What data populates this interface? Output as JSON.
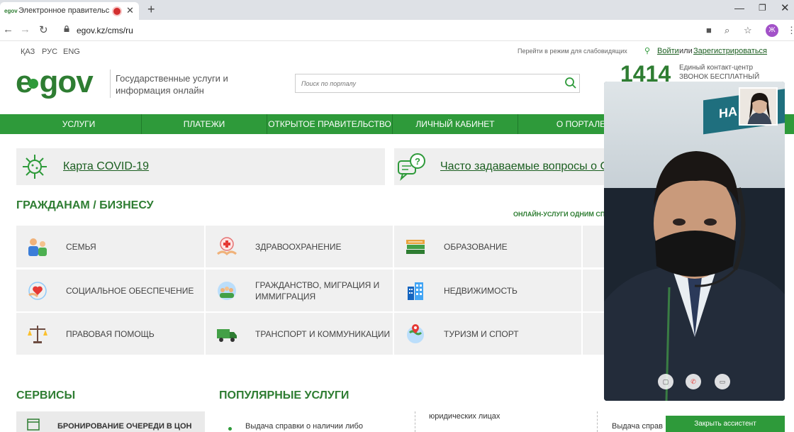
{
  "browser": {
    "tab_title": "Электронное правительство",
    "tab_favicon": "egov",
    "url": "egov.kz/cms/ru",
    "profile_initial": "Ж",
    "icons": [
      "back-icon",
      "forward-icon",
      "reload-icon",
      "lock-icon",
      "camera-icon",
      "zoom-icon",
      "star-icon",
      "menu-icon"
    ]
  },
  "utility": {
    "langs": [
      "ҚАЗ",
      "РУС",
      "ENG"
    ],
    "visual_mode": "Перейти в режим для слабовидящих",
    "login": "Войти",
    "or": "или",
    "register": "Зарегистрироваться"
  },
  "header": {
    "logo": "egov",
    "tagline": "Государственные услуги и информация онлайн",
    "search_placeholder": "Поиск по порталу",
    "callcenter_number": "1414",
    "callcenter_title": "Единый контакт-центр",
    "callcenter_free": "ЗВОНОК БЕСПЛАТНЫЙ"
  },
  "nav": [
    "УСЛУГИ",
    "ПЛАТЕЖИ",
    "ОТКРЫТОЕ ПРАВИТЕЛЬСТВО",
    "ЛИЧНЫЙ КАБИНЕТ",
    "О ПОРТАЛЕ"
  ],
  "banners": {
    "covid": "Карта COVID-19",
    "faq": "Часто задаваемые вопросы о CO"
  },
  "citizens": {
    "title": "ГРАЖДАНАМ / БИЗНЕСУ",
    "one_list": "ОНЛАЙН-УСЛУГИ ОДНИМ СПИС",
    "categories": [
      {
        "label": "СЕМЬЯ",
        "icon": "family-icon"
      },
      {
        "label": "ЗДРАВООХРАНЕНИЕ",
        "icon": "healthcare-icon"
      },
      {
        "label": "ОБРАЗОВАНИЕ",
        "icon": "books-icon"
      },
      {
        "label": "СОЦИАЛЬНОЕ ОБЕСПЕЧЕНИЕ",
        "icon": "social-care-icon"
      },
      {
        "label": "ГРАЖДАНСТВО, МИГРАЦИЯ И",
        "label2": "ИММИГРАЦИЯ",
        "icon": "migration-icon"
      },
      {
        "label": "НЕДВИЖИМОСТЬ",
        "icon": "building-icon"
      },
      {
        "label": "ПРАВОВАЯ ПОМОЩЬ",
        "icon": "scales-icon"
      },
      {
        "label": "ТРАНСПОРТ И КОММУНИКАЦИИ",
        "icon": "truck-icon"
      },
      {
        "label": "ТУРИЗМ И СПОРТ",
        "icon": "globe-pin-icon"
      }
    ]
  },
  "services": {
    "title": "СЕРВИСЫ",
    "card": "БРОНИРОВАНИЕ ОЧЕРЕДИ В ЦОН"
  },
  "popular": {
    "title": "ПОПУЛЯРНЫЕ УСЛУГИ",
    "items": [
      "Выдача справки о наличии либо",
      "юридических лицах",
      "Выдача справ"
    ]
  },
  "video_call": {
    "banner_text": "НА ГРИ",
    "close_assistant": "Закрыть ассистент"
  },
  "colors": {
    "brand_green": "#2e9a3a",
    "dark_green": "#2e7d32",
    "link_green": "#1b5e20",
    "card_bg": "#f0f0f0"
  }
}
